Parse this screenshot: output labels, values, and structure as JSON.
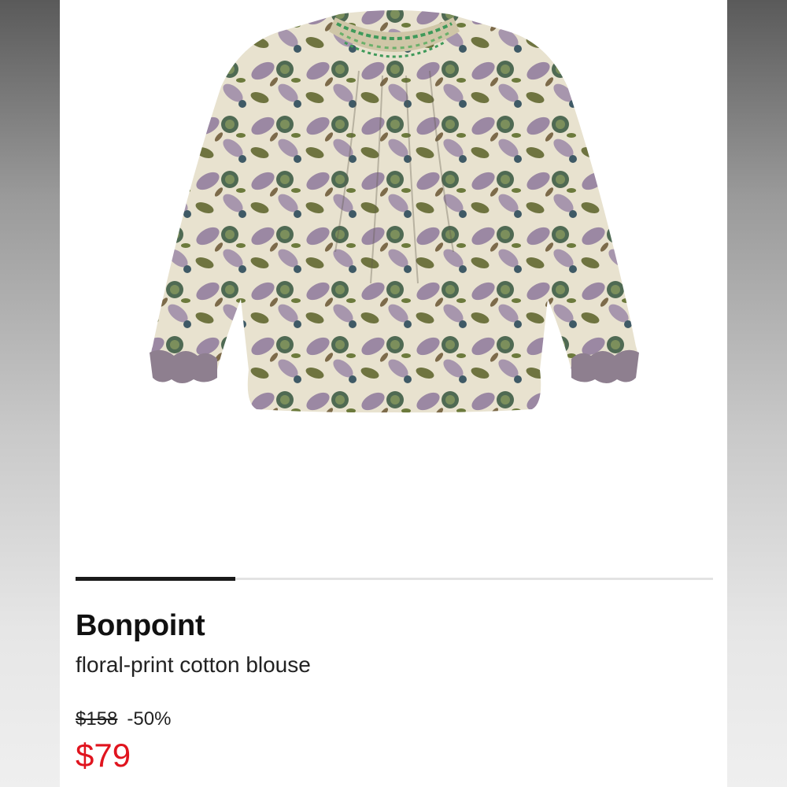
{
  "product": {
    "brand": "Bonpoint",
    "description": "floral-print cotton blouse",
    "original_price": "$158",
    "discount": "-50%",
    "sale_price": "$79",
    "image_icon": "floral-blouse-image"
  },
  "carousel": {
    "active_index_fraction": 0.25
  },
  "colors": {
    "accent_sale": "#e0141e",
    "indicator": "#1a1a1a",
    "track": "#e3e3e3"
  }
}
